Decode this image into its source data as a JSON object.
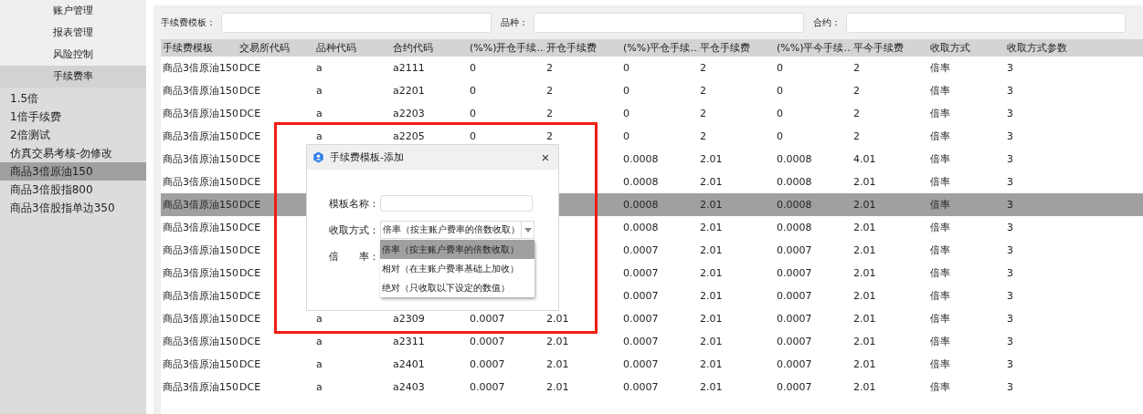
{
  "sidebar": {
    "menu": [
      {
        "label": "账户管理",
        "selected": false
      },
      {
        "label": "报表管理",
        "selected": false
      },
      {
        "label": "风险控制",
        "selected": false
      },
      {
        "label": "手续费率",
        "selected": true
      }
    ],
    "templates": [
      {
        "label": "1.5倍",
        "selected": false
      },
      {
        "label": "1倍手续费",
        "selected": false
      },
      {
        "label": "2倍测试",
        "selected": false
      },
      {
        "label": "仿真交易考核-勿修改",
        "selected": false
      },
      {
        "label": "商品3倍原油150",
        "selected": true
      },
      {
        "label": "商品3倍股指800",
        "selected": false
      },
      {
        "label": "商品3倍股指单边350",
        "selected": false
      }
    ]
  },
  "filters": [
    {
      "label": "手续费模板："
    },
    {
      "label": "品种："
    },
    {
      "label": "合约："
    }
  ],
  "table": {
    "columns": [
      "手续费模板",
      "交易所代码",
      "品种代码",
      "合约代码",
      "(%%)开仓手续...",
      "开仓手续费",
      "(%%)平仓手续...",
      "平仓手续费",
      "(%%)平今手续...",
      "平今手续费",
      "收取方式",
      "收取方式参数"
    ],
    "rows": [
      {
        "selected": false,
        "cells": [
          "商品3倍原油150",
          "DCE",
          "a",
          "a2111",
          "0",
          "2",
          "0",
          "2",
          "0",
          "2",
          "倍率",
          "3"
        ]
      },
      {
        "selected": false,
        "cells": [
          "商品3倍原油150",
          "DCE",
          "a",
          "a2201",
          "0",
          "2",
          "0",
          "2",
          "0",
          "2",
          "倍率",
          "3"
        ]
      },
      {
        "selected": false,
        "cells": [
          "商品3倍原油150",
          "DCE",
          "a",
          "a2203",
          "0",
          "2",
          "0",
          "2",
          "0",
          "2",
          "倍率",
          "3"
        ]
      },
      {
        "selected": false,
        "cells": [
          "商品3倍原油150",
          "DCE",
          "a",
          "a2205",
          "0",
          "2",
          "0",
          "2",
          "0",
          "2",
          "倍率",
          "3"
        ]
      },
      {
        "selected": false,
        "cells": [
          "商品3倍原油150",
          "DCE",
          null,
          null,
          null,
          null,
          "0.0008",
          "2.01",
          "0.0008",
          "4.01",
          "倍率",
          "3"
        ]
      },
      {
        "selected": false,
        "cells": [
          "商品3倍原油150",
          "DCE",
          null,
          null,
          null,
          null,
          "0.0008",
          "2.01",
          "0.0008",
          "2.01",
          "倍率",
          "3"
        ]
      },
      {
        "selected": true,
        "cells": [
          "商品3倍原油150",
          "DCE",
          null,
          null,
          null,
          null,
          "0.0008",
          "2.01",
          "0.0008",
          "2.01",
          "倍率",
          "3"
        ]
      },
      {
        "selected": false,
        "cells": [
          "商品3倍原油150",
          "DCE",
          null,
          null,
          null,
          null,
          "0.0008",
          "2.01",
          "0.0008",
          "2.01",
          "倍率",
          "3"
        ]
      },
      {
        "selected": false,
        "cells": [
          "商品3倍原油150",
          "DCE",
          null,
          null,
          null,
          null,
          "0.0007",
          "2.01",
          "0.0007",
          "2.01",
          "倍率",
          "3"
        ]
      },
      {
        "selected": false,
        "cells": [
          "商品3倍原油150",
          "DCE",
          null,
          null,
          null,
          null,
          "0.0007",
          "2.01",
          "0.0007",
          "2.01",
          "倍率",
          "3"
        ]
      },
      {
        "selected": false,
        "cells": [
          "商品3倍原油150",
          "DCE",
          null,
          null,
          null,
          null,
          "0.0007",
          "2.01",
          "0.0007",
          "2.01",
          "倍率",
          "3"
        ]
      },
      {
        "selected": false,
        "cells": [
          "商品3倍原油150",
          "DCE",
          "a",
          "a2309",
          "0.0007",
          "2.01",
          "0.0007",
          "2.01",
          "0.0007",
          "2.01",
          "倍率",
          "3"
        ]
      },
      {
        "selected": false,
        "cells": [
          "商品3倍原油150",
          "DCE",
          "a",
          "a2311",
          "0.0007",
          "2.01",
          "0.0007",
          "2.01",
          "0.0007",
          "2.01",
          "倍率",
          "3"
        ]
      },
      {
        "selected": false,
        "cells": [
          "商品3倍原油150",
          "DCE",
          "a",
          "a2401",
          "0.0007",
          "2.01",
          "0.0007",
          "2.01",
          "0.0007",
          "2.01",
          "倍率",
          "3"
        ]
      },
      {
        "selected": false,
        "cells": [
          "商品3倍原油150",
          "DCE",
          "a",
          "a2403",
          "0.0007",
          "2.01",
          "0.0007",
          "2.01",
          "0.0007",
          "2.01",
          "倍率",
          "3"
        ]
      }
    ]
  },
  "dialog": {
    "title": "手续费模板-添加",
    "close": "×",
    "fields": [
      {
        "kind": "input",
        "label": "模板名称："
      },
      {
        "kind": "select",
        "label": "收取方式：",
        "value": "倍率（按主账户费率的倍数收取）"
      },
      {
        "kind": "blank",
        "label": "倍　　率："
      }
    ],
    "dropdown": [
      {
        "label": "倍率（按主账户费率的倍数收取）",
        "selected": true
      },
      {
        "label": "相对（在主账户费率基础上加收）",
        "selected": false
      },
      {
        "label": "绝对（只收取以下设定的数值）",
        "selected": false
      }
    ]
  }
}
